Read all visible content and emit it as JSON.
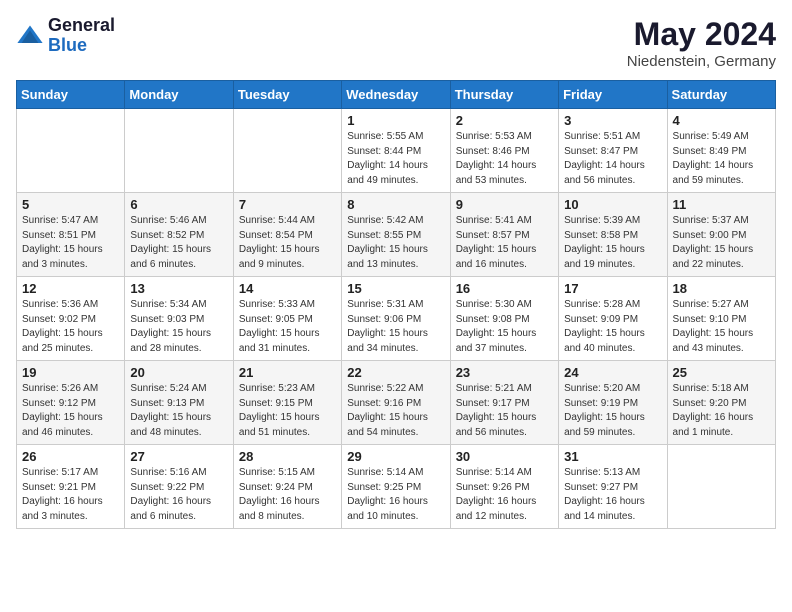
{
  "header": {
    "logo_general": "General",
    "logo_blue": "Blue",
    "month_title": "May 2024",
    "location": "Niedenstein, Germany"
  },
  "days_of_week": [
    "Sunday",
    "Monday",
    "Tuesday",
    "Wednesday",
    "Thursday",
    "Friday",
    "Saturday"
  ],
  "weeks": [
    [
      {
        "day": "",
        "info": ""
      },
      {
        "day": "",
        "info": ""
      },
      {
        "day": "",
        "info": ""
      },
      {
        "day": "1",
        "info": "Sunrise: 5:55 AM\nSunset: 8:44 PM\nDaylight: 14 hours\nand 49 minutes."
      },
      {
        "day": "2",
        "info": "Sunrise: 5:53 AM\nSunset: 8:46 PM\nDaylight: 14 hours\nand 53 minutes."
      },
      {
        "day": "3",
        "info": "Sunrise: 5:51 AM\nSunset: 8:47 PM\nDaylight: 14 hours\nand 56 minutes."
      },
      {
        "day": "4",
        "info": "Sunrise: 5:49 AM\nSunset: 8:49 PM\nDaylight: 14 hours\nand 59 minutes."
      }
    ],
    [
      {
        "day": "5",
        "info": "Sunrise: 5:47 AM\nSunset: 8:51 PM\nDaylight: 15 hours\nand 3 minutes."
      },
      {
        "day": "6",
        "info": "Sunrise: 5:46 AM\nSunset: 8:52 PM\nDaylight: 15 hours\nand 6 minutes."
      },
      {
        "day": "7",
        "info": "Sunrise: 5:44 AM\nSunset: 8:54 PM\nDaylight: 15 hours\nand 9 minutes."
      },
      {
        "day": "8",
        "info": "Sunrise: 5:42 AM\nSunset: 8:55 PM\nDaylight: 15 hours\nand 13 minutes."
      },
      {
        "day": "9",
        "info": "Sunrise: 5:41 AM\nSunset: 8:57 PM\nDaylight: 15 hours\nand 16 minutes."
      },
      {
        "day": "10",
        "info": "Sunrise: 5:39 AM\nSunset: 8:58 PM\nDaylight: 15 hours\nand 19 minutes."
      },
      {
        "day": "11",
        "info": "Sunrise: 5:37 AM\nSunset: 9:00 PM\nDaylight: 15 hours\nand 22 minutes."
      }
    ],
    [
      {
        "day": "12",
        "info": "Sunrise: 5:36 AM\nSunset: 9:02 PM\nDaylight: 15 hours\nand 25 minutes."
      },
      {
        "day": "13",
        "info": "Sunrise: 5:34 AM\nSunset: 9:03 PM\nDaylight: 15 hours\nand 28 minutes."
      },
      {
        "day": "14",
        "info": "Sunrise: 5:33 AM\nSunset: 9:05 PM\nDaylight: 15 hours\nand 31 minutes."
      },
      {
        "day": "15",
        "info": "Sunrise: 5:31 AM\nSunset: 9:06 PM\nDaylight: 15 hours\nand 34 minutes."
      },
      {
        "day": "16",
        "info": "Sunrise: 5:30 AM\nSunset: 9:08 PM\nDaylight: 15 hours\nand 37 minutes."
      },
      {
        "day": "17",
        "info": "Sunrise: 5:28 AM\nSunset: 9:09 PM\nDaylight: 15 hours\nand 40 minutes."
      },
      {
        "day": "18",
        "info": "Sunrise: 5:27 AM\nSunset: 9:10 PM\nDaylight: 15 hours\nand 43 minutes."
      }
    ],
    [
      {
        "day": "19",
        "info": "Sunrise: 5:26 AM\nSunset: 9:12 PM\nDaylight: 15 hours\nand 46 minutes."
      },
      {
        "day": "20",
        "info": "Sunrise: 5:24 AM\nSunset: 9:13 PM\nDaylight: 15 hours\nand 48 minutes."
      },
      {
        "day": "21",
        "info": "Sunrise: 5:23 AM\nSunset: 9:15 PM\nDaylight: 15 hours\nand 51 minutes."
      },
      {
        "day": "22",
        "info": "Sunrise: 5:22 AM\nSunset: 9:16 PM\nDaylight: 15 hours\nand 54 minutes."
      },
      {
        "day": "23",
        "info": "Sunrise: 5:21 AM\nSunset: 9:17 PM\nDaylight: 15 hours\nand 56 minutes."
      },
      {
        "day": "24",
        "info": "Sunrise: 5:20 AM\nSunset: 9:19 PM\nDaylight: 15 hours\nand 59 minutes."
      },
      {
        "day": "25",
        "info": "Sunrise: 5:18 AM\nSunset: 9:20 PM\nDaylight: 16 hours\nand 1 minute."
      }
    ],
    [
      {
        "day": "26",
        "info": "Sunrise: 5:17 AM\nSunset: 9:21 PM\nDaylight: 16 hours\nand 3 minutes."
      },
      {
        "day": "27",
        "info": "Sunrise: 5:16 AM\nSunset: 9:22 PM\nDaylight: 16 hours\nand 6 minutes."
      },
      {
        "day": "28",
        "info": "Sunrise: 5:15 AM\nSunset: 9:24 PM\nDaylight: 16 hours\nand 8 minutes."
      },
      {
        "day": "29",
        "info": "Sunrise: 5:14 AM\nSunset: 9:25 PM\nDaylight: 16 hours\nand 10 minutes."
      },
      {
        "day": "30",
        "info": "Sunrise: 5:14 AM\nSunset: 9:26 PM\nDaylight: 16 hours\nand 12 minutes."
      },
      {
        "day": "31",
        "info": "Sunrise: 5:13 AM\nSunset: 9:27 PM\nDaylight: 16 hours\nand 14 minutes."
      },
      {
        "day": "",
        "info": ""
      }
    ]
  ]
}
